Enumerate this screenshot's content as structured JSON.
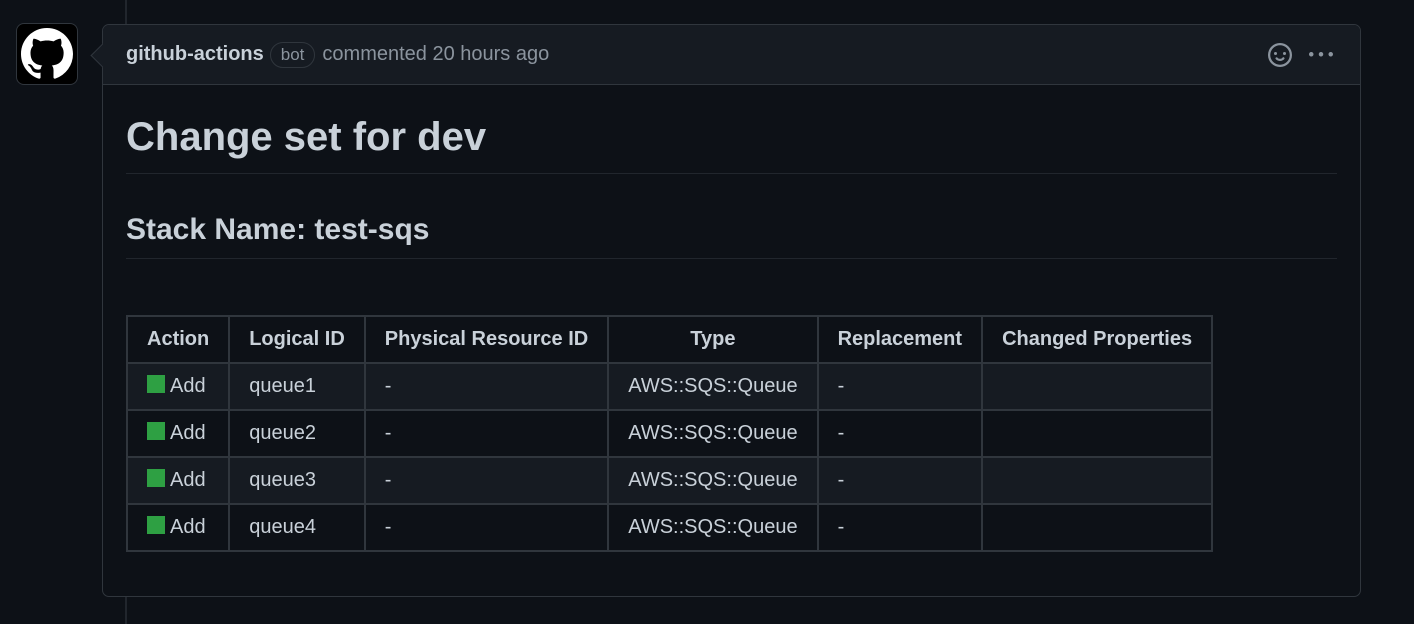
{
  "comment": {
    "author": "github-actions",
    "badge": "bot",
    "meta": "commented 20 hours ago",
    "title": "Change set for dev",
    "subtitle": "Stack Name: test-sqs"
  },
  "table": {
    "headers": [
      "Action",
      "Logical ID",
      "Physical Resource ID",
      "Type",
      "Replacement",
      "Changed Properties"
    ],
    "rows": [
      {
        "action": "Add",
        "logical_id": "queue1",
        "physical_id": "-",
        "type": "AWS::SQS::Queue",
        "replacement": "-",
        "changed": ""
      },
      {
        "action": "Add",
        "logical_id": "queue2",
        "physical_id": "-",
        "type": "AWS::SQS::Queue",
        "replacement": "-",
        "changed": ""
      },
      {
        "action": "Add",
        "logical_id": "queue3",
        "physical_id": "-",
        "type": "AWS::SQS::Queue",
        "replacement": "-",
        "changed": ""
      },
      {
        "action": "Add",
        "logical_id": "queue4",
        "physical_id": "-",
        "type": "AWS::SQS::Queue",
        "replacement": "-",
        "changed": ""
      }
    ]
  },
  "icons": {
    "avatar": "github-mark-icon",
    "reaction": "smiley-icon",
    "menu": "kebab-horizontal-icon",
    "add_marker": "green-square-icon"
  },
  "colors": {
    "add_marker": "#2ea043",
    "background": "#0d1117",
    "border": "#30363d"
  }
}
